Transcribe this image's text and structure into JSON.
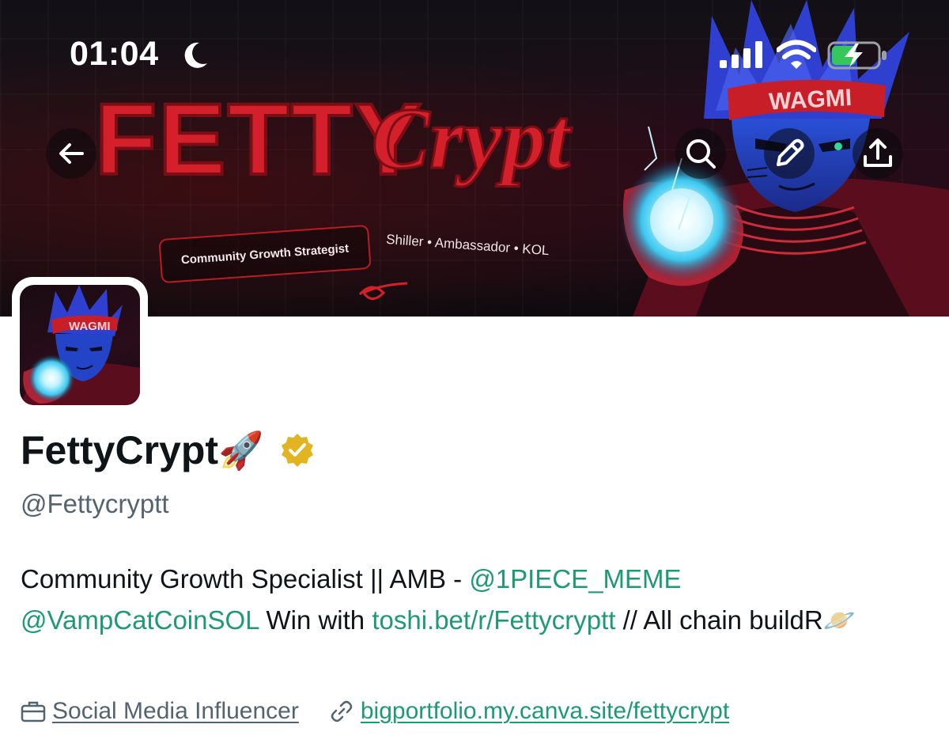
{
  "status_bar": {
    "time": "01:04"
  },
  "banner": {
    "title_left": "FETTY",
    "title_right": "Crypt",
    "headband": "WAGMI",
    "pill_text": "Community Growth Strategist",
    "roles_text": "Shiller • Ambassador • KOL",
    "colors": {
      "accent_red": "#d4202a",
      "energy_blue": "#7fe7ff"
    }
  },
  "nav": {
    "icons": [
      "arrow-left-icon",
      "search-icon",
      "pencil-icon",
      "share-icon"
    ]
  },
  "avatar": {
    "headband": "WAGMI"
  },
  "profile": {
    "display_name": "FettyCrypt",
    "name_emoji": "🚀",
    "handle": "@Fettycryptt",
    "bio": {
      "p1": "Community Growth Specialist || AMB - ",
      "mention1": "@1PIECE_MEME",
      "mention2": "@VampCatCoinSOL",
      "p2": " Win with ",
      "link": "toshi.bet/r/Fettycryptt",
      "p3": " // All chain buildR",
      "emoji": "🪐"
    },
    "category": "Social Media Influencer",
    "website": "bigportfolio.my.canva.site/fettycrypt",
    "colors": {
      "link": "#1d9b6f",
      "muted": "#536471",
      "verified": "#e2b422"
    }
  }
}
